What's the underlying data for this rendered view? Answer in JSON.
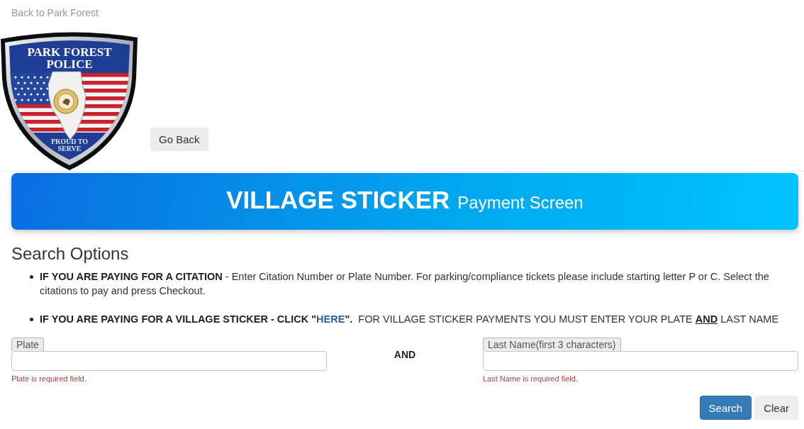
{
  "back_link": "Back to Park Forest",
  "logo": {
    "title_lines": [
      "PARK FOREST",
      "POLICE"
    ],
    "motto_lines": [
      "PROUD TO",
      "SERVE"
    ]
  },
  "go_back_button": "Go Back",
  "banner": {
    "title": "VILLAGE STICKER",
    "subtitle": "Payment Screen"
  },
  "section_title": "Search Options",
  "instructions": [
    {
      "segments": [
        {
          "kind": "text",
          "text": "IF YOU ARE PAYING FOR A CITATION",
          "bold": true,
          "underline": false
        },
        {
          "kind": "text",
          "text": " - Enter Citation Number or Plate Number. For parking/compliance tickets please include starting letter P or C. Select the citations to pay and press Checkout.",
          "bold": false,
          "underline": false
        }
      ]
    },
    {
      "segments": [
        {
          "kind": "text",
          "text": "IF YOU ARE PAYING FOR A VILLAGE STICKER - CLICK \"",
          "bold": true,
          "underline": false
        },
        {
          "kind": "link",
          "text": "HERE",
          "bold": true,
          "underline": false
        },
        {
          "kind": "text",
          "text": "\".",
          "bold": true,
          "underline": false
        },
        {
          "kind": "text",
          "text": "  FOR VILLAGE STICKER PAYMENTS YOU MUST ENTER YOUR PLATE ",
          "bold": false,
          "underline": false
        },
        {
          "kind": "text",
          "text": "AND",
          "bold": true,
          "underline": true
        },
        {
          "kind": "text",
          "text": " LAST NAME",
          "bold": false,
          "underline": false
        }
      ]
    }
  ],
  "fields": [
    {
      "label": "Plate",
      "error": "Plate is required field."
    },
    {
      "label": "Last Name(first 3 characters)",
      "error": "Last Name is required field."
    }
  ],
  "connector": "AND",
  "buttons": [
    {
      "label": "Search",
      "kind": "primary"
    },
    {
      "label": "Clear",
      "kind": "secondary"
    }
  ]
}
